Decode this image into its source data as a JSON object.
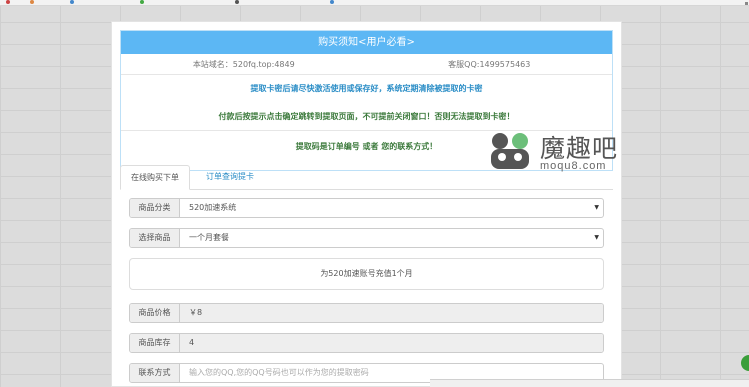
{
  "notice": {
    "title": "购买须知<用户必看>",
    "site_domain": "本站域名：520fq.top:4849",
    "support_qq": "客服QQ:1499575463",
    "line1": "提取卡密后请尽快激活使用或保存好，系统定期清除被提取的卡密",
    "line2": "付款后按提示点击确定跳转到提取页面，不可提前关闭窗口！否则无法提取到卡密！",
    "line3": "提取码是订单编号 或者 您的联系方式！"
  },
  "tabs": {
    "buy": "在线购买下单",
    "query": "订单查询提卡"
  },
  "form": {
    "category_label": "商品分类",
    "category_value": "520加速系统",
    "product_label": "选择商品",
    "product_value": "一个月套餐",
    "description": "为520加速账号充值1个月",
    "price_label": "商品价格",
    "price_value": "￥8",
    "stock_label": "商品库存",
    "stock_value": "4",
    "contact_label": "联系方式",
    "contact_placeholder": "输入您的QQ,您的QQ号码也可以作为您的提取密码"
  },
  "watermark": {
    "name": "魔趣吧",
    "url": "moqu8.com"
  },
  "colors": {
    "notice_header": "#5cb7f4",
    "link_blue": "#2a8dc6",
    "notice_green": "#3c7a3c"
  }
}
